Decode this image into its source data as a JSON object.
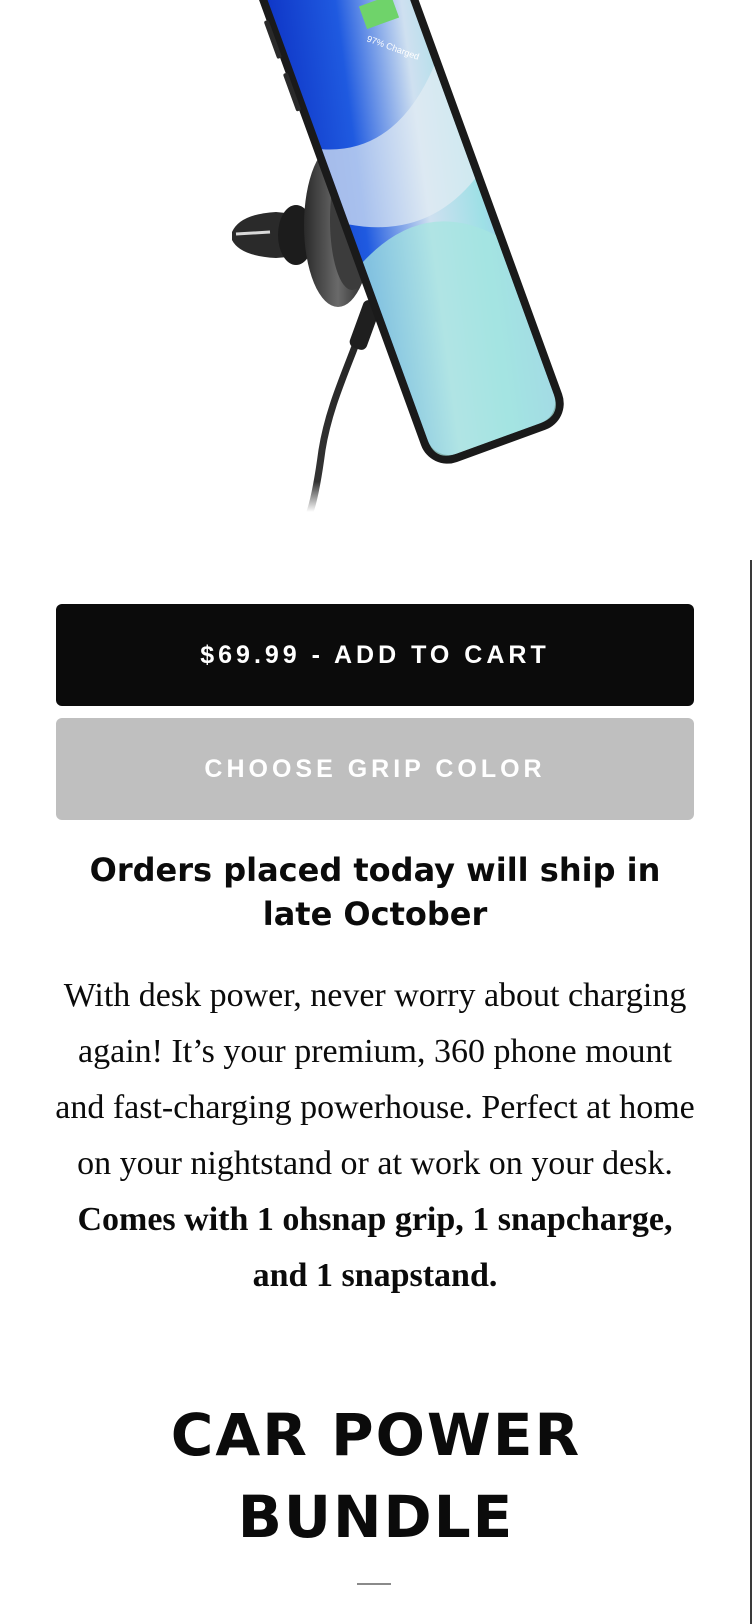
{
  "product_image": {
    "alt": "Phone mounted on car vent charger",
    "screen_caption": "97% Charged"
  },
  "buttons": {
    "add_to_cart": "$69.99 - ADD TO CART",
    "choose_grip": "CHOOSE GRIP COLOR"
  },
  "shipping_notice": "Orders placed today will ship in late October",
  "description": {
    "text": "With desk power, never worry about charging again! It’s your premium, 360 phone mount and fast-charging powerhouse. Perfect at home on your nightstand or at work on your desk.",
    "bold": "Comes with 1 ohsnap grip, 1 snapcharge, and 1 snapstand."
  },
  "section_heading": "CAR POWER BUNDLE",
  "colors": {
    "primary_button": "#0b0b0b",
    "disabled_button": "#bfbfbf",
    "text": "#0b0b0b"
  }
}
